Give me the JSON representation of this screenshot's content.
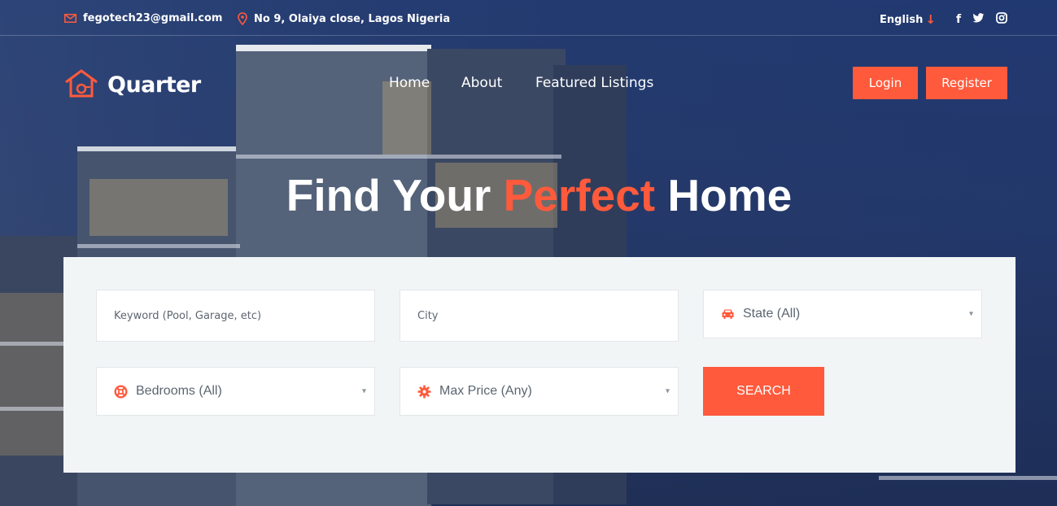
{
  "topbar": {
    "email": "fegotech23@gmail.com",
    "address": "No 9, Olaiya close, Lagos Nigeria",
    "language": "English",
    "social": [
      "facebook-icon",
      "twitter-icon",
      "instagram-icon"
    ]
  },
  "brand": {
    "name": "Quarter",
    "accent": "#ff5a3c"
  },
  "nav": {
    "items": [
      "Home",
      "About",
      "Featured Listings"
    ]
  },
  "auth": {
    "login": "Login",
    "register": "Register"
  },
  "hero": {
    "title_before": "Find Your",
    "title_highlight": "Perfect",
    "title_after": "Home"
  },
  "search": {
    "keyword_placeholder": "Keyword (Pool, Garage, etc)",
    "city_placeholder": "City",
    "state_label": "State (All)",
    "bedrooms_label": "Bedrooms (All)",
    "price_label": "Max Price (Any)",
    "button": "SEARCH"
  }
}
